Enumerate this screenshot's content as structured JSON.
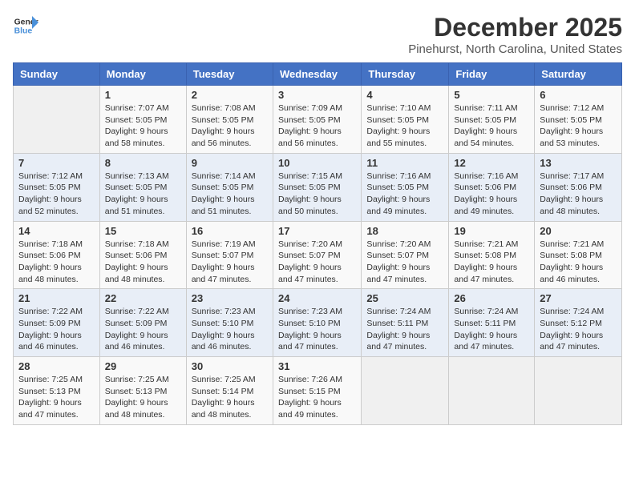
{
  "header": {
    "logo_line1": "General",
    "logo_line2": "Blue",
    "month": "December 2025",
    "location": "Pinehurst, North Carolina, United States"
  },
  "weekdays": [
    "Sunday",
    "Monday",
    "Tuesday",
    "Wednesday",
    "Thursday",
    "Friday",
    "Saturday"
  ],
  "weeks": [
    [
      {
        "day": "",
        "sunrise": "",
        "sunset": "",
        "daylight": ""
      },
      {
        "day": "1",
        "sunrise": "Sunrise: 7:07 AM",
        "sunset": "Sunset: 5:05 PM",
        "daylight": "Daylight: 9 hours and 58 minutes."
      },
      {
        "day": "2",
        "sunrise": "Sunrise: 7:08 AM",
        "sunset": "Sunset: 5:05 PM",
        "daylight": "Daylight: 9 hours and 56 minutes."
      },
      {
        "day": "3",
        "sunrise": "Sunrise: 7:09 AM",
        "sunset": "Sunset: 5:05 PM",
        "daylight": "Daylight: 9 hours and 56 minutes."
      },
      {
        "day": "4",
        "sunrise": "Sunrise: 7:10 AM",
        "sunset": "Sunset: 5:05 PM",
        "daylight": "Daylight: 9 hours and 55 minutes."
      },
      {
        "day": "5",
        "sunrise": "Sunrise: 7:11 AM",
        "sunset": "Sunset: 5:05 PM",
        "daylight": "Daylight: 9 hours and 54 minutes."
      },
      {
        "day": "6",
        "sunrise": "Sunrise: 7:12 AM",
        "sunset": "Sunset: 5:05 PM",
        "daylight": "Daylight: 9 hours and 53 minutes."
      }
    ],
    [
      {
        "day": "7",
        "sunrise": "Sunrise: 7:12 AM",
        "sunset": "Sunset: 5:05 PM",
        "daylight": "Daylight: 9 hours and 52 minutes."
      },
      {
        "day": "8",
        "sunrise": "Sunrise: 7:13 AM",
        "sunset": "Sunset: 5:05 PM",
        "daylight": "Daylight: 9 hours and 51 minutes."
      },
      {
        "day": "9",
        "sunrise": "Sunrise: 7:14 AM",
        "sunset": "Sunset: 5:05 PM",
        "daylight": "Daylight: 9 hours and 51 minutes."
      },
      {
        "day": "10",
        "sunrise": "Sunrise: 7:15 AM",
        "sunset": "Sunset: 5:05 PM",
        "daylight": "Daylight: 9 hours and 50 minutes."
      },
      {
        "day": "11",
        "sunrise": "Sunrise: 7:16 AM",
        "sunset": "Sunset: 5:05 PM",
        "daylight": "Daylight: 9 hours and 49 minutes."
      },
      {
        "day": "12",
        "sunrise": "Sunrise: 7:16 AM",
        "sunset": "Sunset: 5:06 PM",
        "daylight": "Daylight: 9 hours and 49 minutes."
      },
      {
        "day": "13",
        "sunrise": "Sunrise: 7:17 AM",
        "sunset": "Sunset: 5:06 PM",
        "daylight": "Daylight: 9 hours and 48 minutes."
      }
    ],
    [
      {
        "day": "14",
        "sunrise": "Sunrise: 7:18 AM",
        "sunset": "Sunset: 5:06 PM",
        "daylight": "Daylight: 9 hours and 48 minutes."
      },
      {
        "day": "15",
        "sunrise": "Sunrise: 7:18 AM",
        "sunset": "Sunset: 5:06 PM",
        "daylight": "Daylight: 9 hours and 48 minutes."
      },
      {
        "day": "16",
        "sunrise": "Sunrise: 7:19 AM",
        "sunset": "Sunset: 5:07 PM",
        "daylight": "Daylight: 9 hours and 47 minutes."
      },
      {
        "day": "17",
        "sunrise": "Sunrise: 7:20 AM",
        "sunset": "Sunset: 5:07 PM",
        "daylight": "Daylight: 9 hours and 47 minutes."
      },
      {
        "day": "18",
        "sunrise": "Sunrise: 7:20 AM",
        "sunset": "Sunset: 5:07 PM",
        "daylight": "Daylight: 9 hours and 47 minutes."
      },
      {
        "day": "19",
        "sunrise": "Sunrise: 7:21 AM",
        "sunset": "Sunset: 5:08 PM",
        "daylight": "Daylight: 9 hours and 47 minutes."
      },
      {
        "day": "20",
        "sunrise": "Sunrise: 7:21 AM",
        "sunset": "Sunset: 5:08 PM",
        "daylight": "Daylight: 9 hours and 46 minutes."
      }
    ],
    [
      {
        "day": "21",
        "sunrise": "Sunrise: 7:22 AM",
        "sunset": "Sunset: 5:09 PM",
        "daylight": "Daylight: 9 hours and 46 minutes."
      },
      {
        "day": "22",
        "sunrise": "Sunrise: 7:22 AM",
        "sunset": "Sunset: 5:09 PM",
        "daylight": "Daylight: 9 hours and 46 minutes."
      },
      {
        "day": "23",
        "sunrise": "Sunrise: 7:23 AM",
        "sunset": "Sunset: 5:10 PM",
        "daylight": "Daylight: 9 hours and 46 minutes."
      },
      {
        "day": "24",
        "sunrise": "Sunrise: 7:23 AM",
        "sunset": "Sunset: 5:10 PM",
        "daylight": "Daylight: 9 hours and 47 minutes."
      },
      {
        "day": "25",
        "sunrise": "Sunrise: 7:24 AM",
        "sunset": "Sunset: 5:11 PM",
        "daylight": "Daylight: 9 hours and 47 minutes."
      },
      {
        "day": "26",
        "sunrise": "Sunrise: 7:24 AM",
        "sunset": "Sunset: 5:11 PM",
        "daylight": "Daylight: 9 hours and 47 minutes."
      },
      {
        "day": "27",
        "sunrise": "Sunrise: 7:24 AM",
        "sunset": "Sunset: 5:12 PM",
        "daylight": "Daylight: 9 hours and 47 minutes."
      }
    ],
    [
      {
        "day": "28",
        "sunrise": "Sunrise: 7:25 AM",
        "sunset": "Sunset: 5:13 PM",
        "daylight": "Daylight: 9 hours and 47 minutes."
      },
      {
        "day": "29",
        "sunrise": "Sunrise: 7:25 AM",
        "sunset": "Sunset: 5:13 PM",
        "daylight": "Daylight: 9 hours and 48 minutes."
      },
      {
        "day": "30",
        "sunrise": "Sunrise: 7:25 AM",
        "sunset": "Sunset: 5:14 PM",
        "daylight": "Daylight: 9 hours and 48 minutes."
      },
      {
        "day": "31",
        "sunrise": "Sunrise: 7:26 AM",
        "sunset": "Sunset: 5:15 PM",
        "daylight": "Daylight: 9 hours and 49 minutes."
      },
      {
        "day": "",
        "sunrise": "",
        "sunset": "",
        "daylight": ""
      },
      {
        "day": "",
        "sunrise": "",
        "sunset": "",
        "daylight": ""
      },
      {
        "day": "",
        "sunrise": "",
        "sunset": "",
        "daylight": ""
      }
    ]
  ]
}
